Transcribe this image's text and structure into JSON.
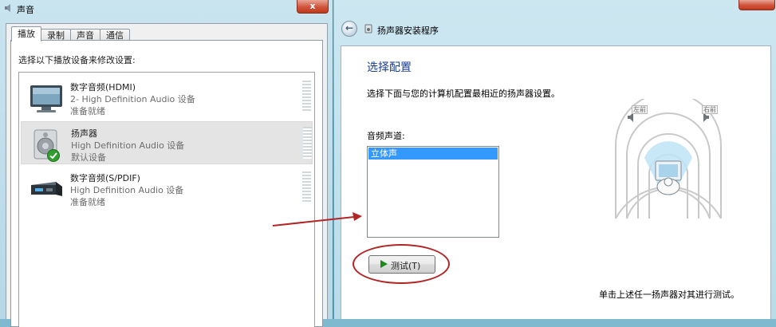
{
  "left_window": {
    "title": "声音",
    "close_label": "x",
    "tabs": [
      {
        "label": "播放",
        "active": true
      },
      {
        "label": "录制",
        "active": false
      },
      {
        "label": "声音",
        "active": false
      },
      {
        "label": "通信",
        "active": false
      }
    ],
    "instruction": "选择以下播放设备来修改设置:",
    "devices": [
      {
        "name": "数字音频(HDMI)",
        "description": "2- High Definition Audio 设备",
        "status": "准备就绪",
        "icon": "monitor-icon",
        "selected": false
      },
      {
        "name": "扬声器",
        "description": "High Definition Audio 设备",
        "status": "默认设备",
        "icon": "speaker-icon",
        "selected": true
      },
      {
        "name": "数字音频(S/PDIF)",
        "description": "High Definition Audio 设备",
        "status": "准备就绪",
        "icon": "spdif-device-icon",
        "selected": false
      }
    ]
  },
  "right_window": {
    "title": "扬声器安装程序",
    "heading": "选择配置",
    "description": "选择下面与您的计算机配置最相近的扬声器设置。",
    "channel_label": "音频声道:",
    "channel_options": [
      "立体声"
    ],
    "selected_channel": "立体声",
    "test_button": "测试(T)",
    "hint": "单击上述任一扬声器对其进行测试。",
    "diagram": {
      "left_tag": "左前",
      "right_tag": "右前"
    }
  },
  "colors": {
    "heading": "#1b3f8f",
    "selection": "#3399ff",
    "annotation": "#b32424",
    "play": "#1b8a1b"
  }
}
